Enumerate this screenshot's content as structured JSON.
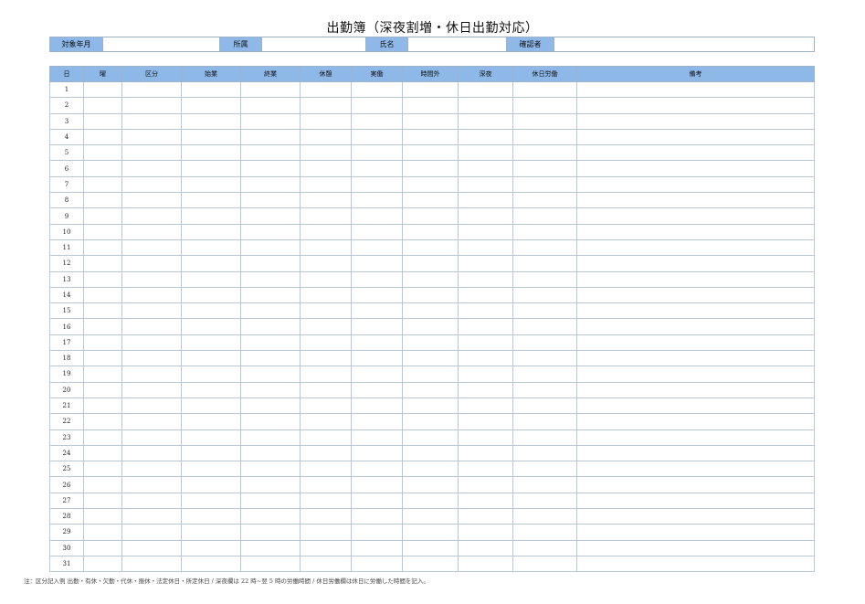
{
  "title": "出勤簿（深夜割増・休日出勤対応）",
  "info": {
    "month_label": "対象年月",
    "month_value": "",
    "dept_label": "所属",
    "dept_value": "",
    "name_label": "氏名",
    "name_value": "",
    "checker_label": "確認者",
    "checker_value": ""
  },
  "columns": [
    "日",
    "曜",
    "区分",
    "始業",
    "終業",
    "休憩",
    "実働",
    "時間外",
    "深夜",
    "休日労働",
    "備考"
  ],
  "days": [
    "1",
    "2",
    "3",
    "4",
    "5",
    "6",
    "7",
    "8",
    "9",
    "10",
    "11",
    "12",
    "13",
    "14",
    "15",
    "16",
    "17",
    "18",
    "19",
    "20",
    "21",
    "22",
    "23",
    "24",
    "25",
    "26",
    "27",
    "28",
    "29",
    "30",
    "31"
  ],
  "footnote": "注：区分記入例 出勤・有休・欠勤・代休・振休・法定休日・所定休日 / 深夜欄は 22 時~翌 5 時の労働時間 / 休日労働欄は休日に労働した時間を記入。",
  "colors": {
    "header_fill": "#8db8e8",
    "border": "#b9c7d6"
  }
}
